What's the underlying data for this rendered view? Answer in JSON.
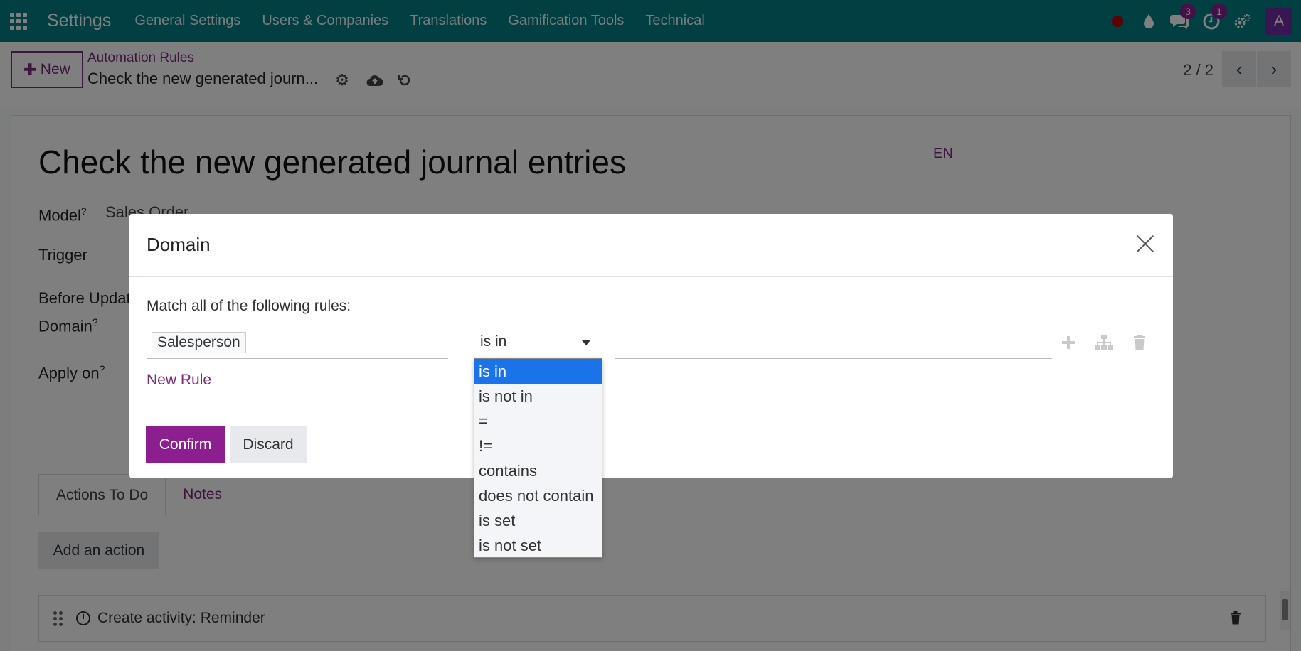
{
  "navbar": {
    "brand": "Settings",
    "menu": [
      "General Settings",
      "Users & Companies",
      "Translations",
      "Gamification Tools",
      "Technical"
    ],
    "messages_badge": "3",
    "activities_badge": "1",
    "avatar_letter": "A"
  },
  "control_panel": {
    "new_label": "New",
    "breadcrumb": "Automation Rules",
    "record_title": "Check the new generated journ...",
    "pager": "2 / 2"
  },
  "form": {
    "title": "Check the new generated journal entries",
    "lang": "EN",
    "model_label": "Model",
    "model_value": "Sales Order",
    "trigger_label": "Trigger",
    "before_update_label": "Before Updat",
    "domain_label": "Domain",
    "apply_on_label": "Apply on",
    "help_mark": "?",
    "tabs": [
      "Actions To Do",
      "Notes"
    ],
    "add_action_label": "Add an action",
    "action_row_label": "Create activity: Reminder"
  },
  "modal": {
    "title": "Domain",
    "match_label": "Match all of the following rules:",
    "path_value": "Salesperson",
    "operator_value": "is in",
    "new_rule_label": "New Rule",
    "confirm_label": "Confirm",
    "discard_label": "Discard"
  },
  "operator_options": [
    "is in",
    "is not in",
    "=",
    "!=",
    "contains",
    "does not contain",
    "is set",
    "is not set"
  ],
  "colors": {
    "navbar": "#017e84",
    "primary": "#8d1e8f",
    "link": "#7c2a7e",
    "dropdown_selected": "#1a73e8"
  }
}
